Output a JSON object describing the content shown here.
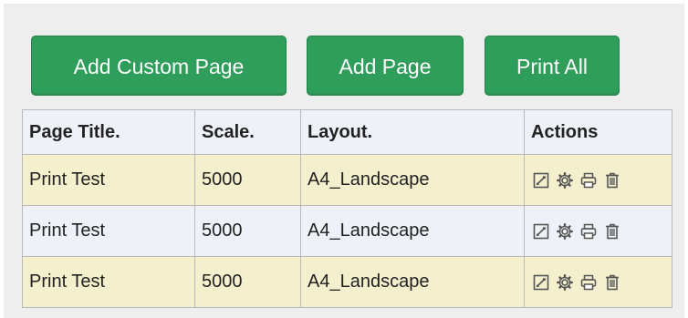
{
  "toolbar": {
    "add_custom_page": "Add Custom Page",
    "add_page": "Add Page",
    "print_all": "Print All",
    "button_color": "#2f9e5b"
  },
  "table": {
    "headers": {
      "page_title": "Page Title.",
      "scale": "Scale.",
      "layout": "Layout.",
      "actions": "Actions"
    },
    "rows": [
      {
        "page_title": "Print Test",
        "scale": "5000",
        "layout": "A4_Landscape"
      },
      {
        "page_title": "Print Test",
        "scale": "5000",
        "layout": "A4_Landscape"
      },
      {
        "page_title": "Print Test",
        "scale": "5000",
        "layout": "A4_Landscape"
      }
    ],
    "action_icons": [
      "edit-icon",
      "settings-gear-icon",
      "print-icon",
      "delete-trash-icon"
    ],
    "row_colors": [
      "#f4f0cd",
      "#eef1f7"
    ]
  }
}
